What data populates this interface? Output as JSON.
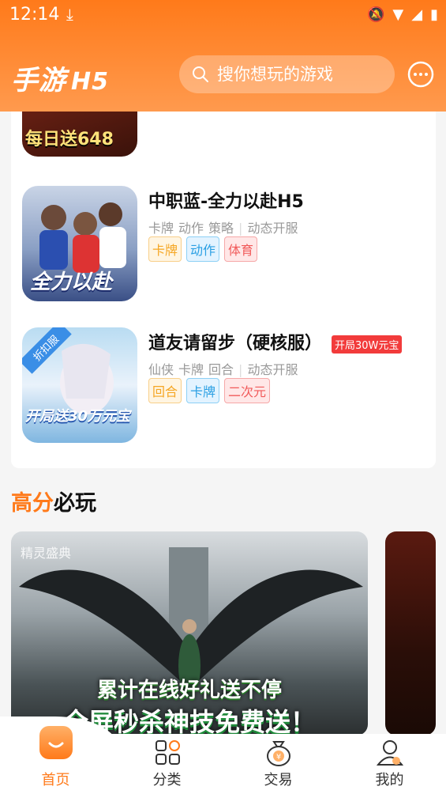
{
  "status_bar": {
    "time": "12:14"
  },
  "header": {
    "logo_main": "手游",
    "logo_sub": "H5",
    "search_placeholder": "搜你想玩的游戏"
  },
  "game_list": [
    {
      "name": "中职蓝-全力以赴H5",
      "promo": "",
      "categories": [
        "卡牌",
        "动作",
        "策略"
      ],
      "server": "动态开服",
      "tags": [
        "卡牌",
        "动作",
        "体育"
      ],
      "thumb_text": "全力以赴"
    },
    {
      "name": "道友请留步（硬核服）",
      "promo": "开局30W元宝",
      "categories": [
        "仙侠",
        "卡牌",
        "回合"
      ],
      "server": "动态开服",
      "tags": [
        "回合",
        "卡牌",
        "二次元"
      ],
      "thumb_text": "开局送30万元宝",
      "thumb_badge": "折扣服"
    }
  ],
  "top_partial_thumb_text": "每日送648",
  "section": {
    "title_accent": "高分",
    "title_rest": "必玩",
    "banner1": {
      "caption": "精灵盛典",
      "line1": "累计在线好礼送不停",
      "line2": "全屏秒杀神技免费送！"
    }
  },
  "bottom_nav": [
    {
      "label": "首页",
      "icon": "home-icon",
      "active": true
    },
    {
      "label": "分类",
      "icon": "category-icon",
      "active": false
    },
    {
      "label": "交易",
      "icon": "trade-money-bag-icon",
      "active": false
    },
    {
      "label": "我的",
      "icon": "profile-icon",
      "active": false
    }
  ],
  "colors": {
    "accent": "#ff7a1a",
    "promo_red": "#f23b3b"
  }
}
